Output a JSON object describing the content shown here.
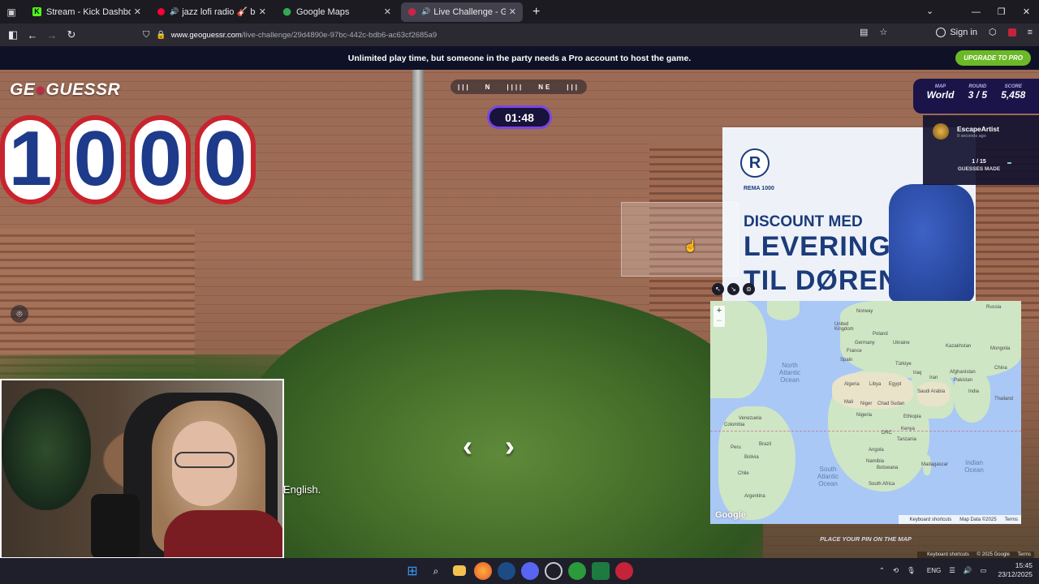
{
  "browser": {
    "tabs": [
      {
        "title": "Stream - Kick Dashboard",
        "favicon": "kick-icon",
        "color": "#53fc18",
        "active": false,
        "audio": false
      },
      {
        "title": "jazz lofi radio 🎸 beats to c",
        "favicon": "youtube-icon",
        "color": "#ff0033",
        "active": false,
        "audio": true
      },
      {
        "title": "Google Maps",
        "favicon": "maps-pin-icon",
        "color": "#34a853",
        "active": false,
        "audio": false
      },
      {
        "title": "Live Challenge - GeoGuessr",
        "favicon": "geoguessr-pin-icon",
        "color": "#c5264a",
        "active": true,
        "audio": true
      }
    ],
    "url_host": "www.geoguessr.com",
    "url_path": "/live-challenge/29d4890e-97bc-442c-bdb6-ac63cf2685a9",
    "sign_in_label": "Sign in",
    "extension_badge": "7"
  },
  "game": {
    "banner_text": "Unlimited play time, but someone in the party needs a Pro account to host the game.",
    "upgrade_label": "UPGRADE TO PRO",
    "logo_text": "GEOGUESSR",
    "compass": [
      "N",
      "NE"
    ],
    "timer": "01:48",
    "stats": {
      "map_label": "MAP",
      "map_value": "World",
      "round_label": "ROUND",
      "round_value": "3 / 5",
      "score_label": "SCORE",
      "score_value": "5,458"
    },
    "player": {
      "name": "EscapeArtist",
      "time": "9 seconds ago",
      "count": "1 / 15",
      "guesses_label": "GUESSES MADE"
    },
    "scene": {
      "store_number": "1000",
      "sign_brand": "R",
      "sign_small": "REMA 1000",
      "sign_line1": "DISCOUNT MED",
      "sign_line2": "LEVERING",
      "sign_line3": "TIL DØREN"
    },
    "place_pin_label": "PLACE YOUR PIN ON THE MAP",
    "keyboard_shortcuts": "Keyboard shortcuts",
    "copyright": "© 2025 Google",
    "terms": "Terms"
  },
  "map": {
    "labels": {
      "russia": "Russia",
      "norway": "Norway",
      "uk": "United Kingdom",
      "poland": "Poland",
      "ukraine": "Ukraine",
      "kazakhstan": "Kazakhstan",
      "mongolia": "Mongolia",
      "germany": "Germany",
      "france": "France",
      "spain": "Spain",
      "turkiye": "Türkiye",
      "china": "China",
      "iraq": "Iraq",
      "iran": "Iran",
      "afghanistan": "Afghanistan",
      "pakistan": "Pakistan",
      "india": "India",
      "thailand": "Thailand",
      "algeria": "Algeria",
      "libya": "Libya",
      "egypt": "Egypt",
      "saudi": "Saudi Arabia",
      "mali": "Mali",
      "niger": "Niger",
      "chad": "Chad",
      "sudan": "Sudan",
      "nigeria": "Nigeria",
      "ethiopia": "Ethiopia",
      "kenya": "Kenya",
      "drc": "DRC",
      "tanzania": "Tanzania",
      "angola": "Angola",
      "namibia": "Namibia",
      "botswana": "Botswana",
      "madagascar": "Madagascar",
      "south_africa": "South Africa",
      "venezuela": "Venezuela",
      "colombia": "Colombia",
      "peru": "Peru",
      "brazil": "Brazil",
      "bolivia": "Bolivia",
      "chile": "Chile",
      "argentina": "Argentina",
      "north_atlantic": "North Atlantic Ocean",
      "south_atlantic": "South Atlantic Ocean",
      "indian": "Indian Ocean"
    },
    "google": "Google",
    "attr_shortcuts": "Keyboard shortcuts",
    "attr_data": "Map Data ©2025",
    "attr_terms": "Terms"
  },
  "stream": {
    "caption": "English."
  },
  "taskbar": {
    "lang": "ENG",
    "time": "15:45",
    "date": "23/12/2025"
  }
}
